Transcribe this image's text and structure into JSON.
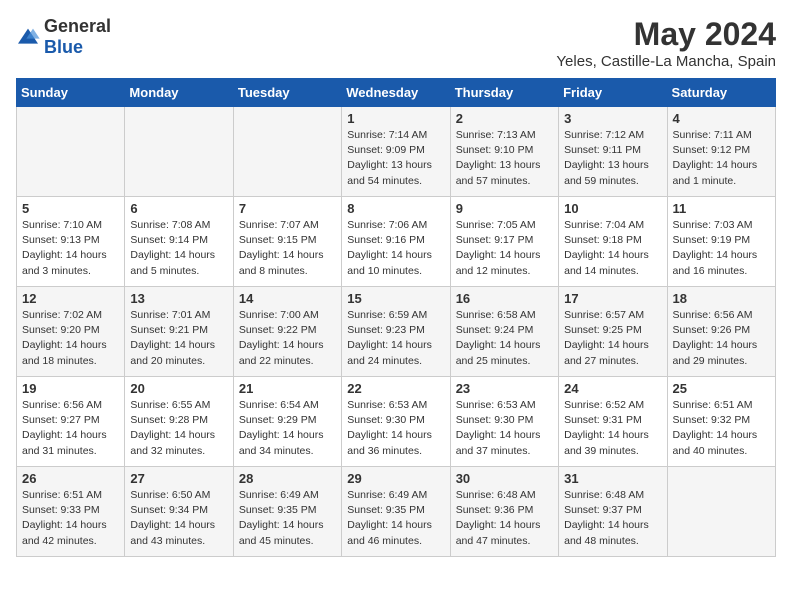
{
  "header": {
    "logo_general": "General",
    "logo_blue": "Blue",
    "month_year": "May 2024",
    "location": "Yeles, Castille-La Mancha, Spain"
  },
  "days_of_week": [
    "Sunday",
    "Monday",
    "Tuesday",
    "Wednesday",
    "Thursday",
    "Friday",
    "Saturday"
  ],
  "weeks": [
    [
      {
        "day": "",
        "sunrise": "",
        "sunset": "",
        "daylight": ""
      },
      {
        "day": "",
        "sunrise": "",
        "sunset": "",
        "daylight": ""
      },
      {
        "day": "",
        "sunrise": "",
        "sunset": "",
        "daylight": ""
      },
      {
        "day": "1",
        "sunrise": "Sunrise: 7:14 AM",
        "sunset": "Sunset: 9:09 PM",
        "daylight": "Daylight: 13 hours and 54 minutes."
      },
      {
        "day": "2",
        "sunrise": "Sunrise: 7:13 AM",
        "sunset": "Sunset: 9:10 PM",
        "daylight": "Daylight: 13 hours and 57 minutes."
      },
      {
        "day": "3",
        "sunrise": "Sunrise: 7:12 AM",
        "sunset": "Sunset: 9:11 PM",
        "daylight": "Daylight: 13 hours and 59 minutes."
      },
      {
        "day": "4",
        "sunrise": "Sunrise: 7:11 AM",
        "sunset": "Sunset: 9:12 PM",
        "daylight": "Daylight: 14 hours and 1 minute."
      }
    ],
    [
      {
        "day": "5",
        "sunrise": "Sunrise: 7:10 AM",
        "sunset": "Sunset: 9:13 PM",
        "daylight": "Daylight: 14 hours and 3 minutes."
      },
      {
        "day": "6",
        "sunrise": "Sunrise: 7:08 AM",
        "sunset": "Sunset: 9:14 PM",
        "daylight": "Daylight: 14 hours and 5 minutes."
      },
      {
        "day": "7",
        "sunrise": "Sunrise: 7:07 AM",
        "sunset": "Sunset: 9:15 PM",
        "daylight": "Daylight: 14 hours and 8 minutes."
      },
      {
        "day": "8",
        "sunrise": "Sunrise: 7:06 AM",
        "sunset": "Sunset: 9:16 PM",
        "daylight": "Daylight: 14 hours and 10 minutes."
      },
      {
        "day": "9",
        "sunrise": "Sunrise: 7:05 AM",
        "sunset": "Sunset: 9:17 PM",
        "daylight": "Daylight: 14 hours and 12 minutes."
      },
      {
        "day": "10",
        "sunrise": "Sunrise: 7:04 AM",
        "sunset": "Sunset: 9:18 PM",
        "daylight": "Daylight: 14 hours and 14 minutes."
      },
      {
        "day": "11",
        "sunrise": "Sunrise: 7:03 AM",
        "sunset": "Sunset: 9:19 PM",
        "daylight": "Daylight: 14 hours and 16 minutes."
      }
    ],
    [
      {
        "day": "12",
        "sunrise": "Sunrise: 7:02 AM",
        "sunset": "Sunset: 9:20 PM",
        "daylight": "Daylight: 14 hours and 18 minutes."
      },
      {
        "day": "13",
        "sunrise": "Sunrise: 7:01 AM",
        "sunset": "Sunset: 9:21 PM",
        "daylight": "Daylight: 14 hours and 20 minutes."
      },
      {
        "day": "14",
        "sunrise": "Sunrise: 7:00 AM",
        "sunset": "Sunset: 9:22 PM",
        "daylight": "Daylight: 14 hours and 22 minutes."
      },
      {
        "day": "15",
        "sunrise": "Sunrise: 6:59 AM",
        "sunset": "Sunset: 9:23 PM",
        "daylight": "Daylight: 14 hours and 24 minutes."
      },
      {
        "day": "16",
        "sunrise": "Sunrise: 6:58 AM",
        "sunset": "Sunset: 9:24 PM",
        "daylight": "Daylight: 14 hours and 25 minutes."
      },
      {
        "day": "17",
        "sunrise": "Sunrise: 6:57 AM",
        "sunset": "Sunset: 9:25 PM",
        "daylight": "Daylight: 14 hours and 27 minutes."
      },
      {
        "day": "18",
        "sunrise": "Sunrise: 6:56 AM",
        "sunset": "Sunset: 9:26 PM",
        "daylight": "Daylight: 14 hours and 29 minutes."
      }
    ],
    [
      {
        "day": "19",
        "sunrise": "Sunrise: 6:56 AM",
        "sunset": "Sunset: 9:27 PM",
        "daylight": "Daylight: 14 hours and 31 minutes."
      },
      {
        "day": "20",
        "sunrise": "Sunrise: 6:55 AM",
        "sunset": "Sunset: 9:28 PM",
        "daylight": "Daylight: 14 hours and 32 minutes."
      },
      {
        "day": "21",
        "sunrise": "Sunrise: 6:54 AM",
        "sunset": "Sunset: 9:29 PM",
        "daylight": "Daylight: 14 hours and 34 minutes."
      },
      {
        "day": "22",
        "sunrise": "Sunrise: 6:53 AM",
        "sunset": "Sunset: 9:30 PM",
        "daylight": "Daylight: 14 hours and 36 minutes."
      },
      {
        "day": "23",
        "sunrise": "Sunrise: 6:53 AM",
        "sunset": "Sunset: 9:30 PM",
        "daylight": "Daylight: 14 hours and 37 minutes."
      },
      {
        "day": "24",
        "sunrise": "Sunrise: 6:52 AM",
        "sunset": "Sunset: 9:31 PM",
        "daylight": "Daylight: 14 hours and 39 minutes."
      },
      {
        "day": "25",
        "sunrise": "Sunrise: 6:51 AM",
        "sunset": "Sunset: 9:32 PM",
        "daylight": "Daylight: 14 hours and 40 minutes."
      }
    ],
    [
      {
        "day": "26",
        "sunrise": "Sunrise: 6:51 AM",
        "sunset": "Sunset: 9:33 PM",
        "daylight": "Daylight: 14 hours and 42 minutes."
      },
      {
        "day": "27",
        "sunrise": "Sunrise: 6:50 AM",
        "sunset": "Sunset: 9:34 PM",
        "daylight": "Daylight: 14 hours and 43 minutes."
      },
      {
        "day": "28",
        "sunrise": "Sunrise: 6:49 AM",
        "sunset": "Sunset: 9:35 PM",
        "daylight": "Daylight: 14 hours and 45 minutes."
      },
      {
        "day": "29",
        "sunrise": "Sunrise: 6:49 AM",
        "sunset": "Sunset: 9:35 PM",
        "daylight": "Daylight: 14 hours and 46 minutes."
      },
      {
        "day": "30",
        "sunrise": "Sunrise: 6:48 AM",
        "sunset": "Sunset: 9:36 PM",
        "daylight": "Daylight: 14 hours and 47 minutes."
      },
      {
        "day": "31",
        "sunrise": "Sunrise: 6:48 AM",
        "sunset": "Sunset: 9:37 PM",
        "daylight": "Daylight: 14 hours and 48 minutes."
      },
      {
        "day": "",
        "sunrise": "",
        "sunset": "",
        "daylight": ""
      }
    ]
  ]
}
